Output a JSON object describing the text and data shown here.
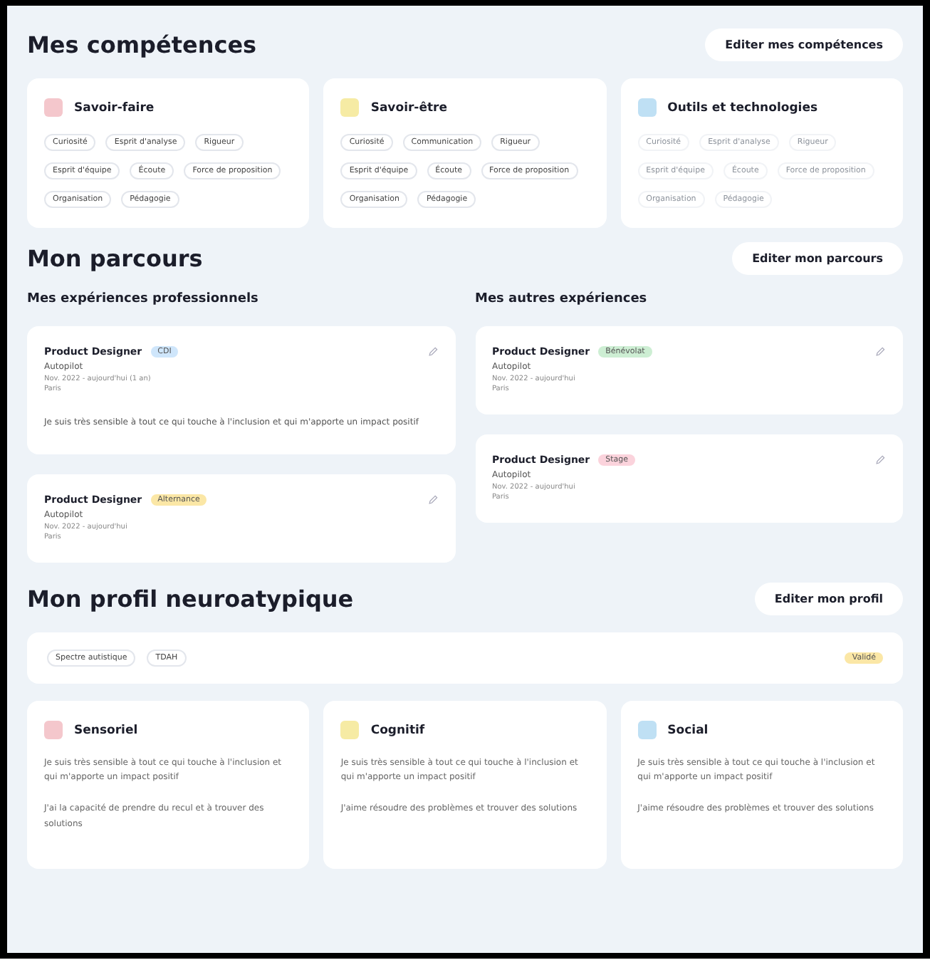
{
  "skills": {
    "title": "Mes compétences",
    "edit_button": "Editer mes compétences",
    "cards": [
      {
        "title": "Savoir-faire",
        "color": "#f4c7cc",
        "muted": false,
        "tags": [
          "Curiosité",
          "Esprit d'analyse",
          "Rigueur",
          "Esprit d'équipe",
          "Écoute",
          "Force de proposition",
          "Organisation",
          "Pédagogie"
        ]
      },
      {
        "title": "Savoir-être",
        "color": "#f6eba4",
        "muted": false,
        "tags": [
          "Curiosité",
          "Communication",
          "Rigueur",
          "Esprit d'équipe",
          "Écoute",
          "Force de proposition",
          "Organisation",
          "Pédagogie"
        ]
      },
      {
        "title": "Outils et technologies",
        "color": "#bfe0f4",
        "muted": true,
        "tags": [
          "Curiosité",
          "Esprit d'analyse",
          "Rigueur",
          "Esprit d'équipe",
          "Écoute",
          "Force de proposition",
          "Organisation",
          "Pédagogie"
        ]
      }
    ]
  },
  "journey": {
    "title": "Mon parcours",
    "edit_button": "Editer mon parcours",
    "columns": [
      {
        "title": "Mes expériences professionnels",
        "items": [
          {
            "role": "Product Designer",
            "badge": "CDI",
            "color": "#cfe6fb",
            "company": "Autopilot",
            "dates": "Nov. 2022 - aujourd'hui (1 an)",
            "place": "Paris",
            "description": "Je suis très sensible à tout ce qui touche à l'inclusion et qui m'apporte un impact positif"
          },
          {
            "role": "Product Designer",
            "badge": "Alternance",
            "color": "#fbe7a6",
            "company": "Autopilot",
            "dates": "Nov. 2022 - aujourd'hui",
            "place": "Paris"
          }
        ]
      },
      {
        "title": "Mes autres expériences",
        "items": [
          {
            "role": "Product Designer",
            "badge": "Bénévolat",
            "color": "#cdeed3",
            "company": "Autopilot",
            "dates": "Nov. 2022 - aujourd'hui",
            "place": "Paris"
          },
          {
            "role": "Product Designer",
            "badge": "Stage",
            "color": "#fbd3dc",
            "company": "Autopilot",
            "dates": "Nov. 2022 - aujourd'hui",
            "place": "Paris"
          }
        ]
      }
    ]
  },
  "profile": {
    "title": "Mon profil neuroatypique",
    "edit_button": "Editer mon profil",
    "tags": [
      "Spectre autistique",
      "TDAH"
    ],
    "status": "Validé",
    "cards": [
      {
        "title": "Sensoriel",
        "color": "#f4c7cc",
        "bullets": [
          "Je suis très sensible à tout ce qui touche à l'inclusion et qui m'apporte un impact positif",
          "J'ai la capacité de prendre du recul et à trouver des solutions"
        ]
      },
      {
        "title": "Cognitif",
        "color": "#f6eba4",
        "bullets": [
          "Je suis très sensible à tout ce qui touche à l'inclusion et qui m'apporte un impact positif",
          "J'aime résoudre des problèmes et trouver des solutions"
        ]
      },
      {
        "title": "Social",
        "color": "#bfe0f4",
        "bullets": [
          "Je suis très sensible à tout ce qui touche à l'inclusion et qui m'apporte un impact positif",
          "J'aime résoudre des problèmes et trouver des solutions"
        ]
      }
    ]
  }
}
